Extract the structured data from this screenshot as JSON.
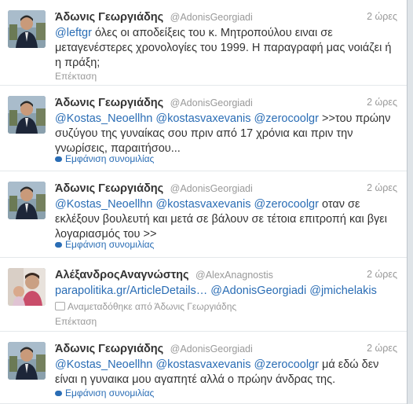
{
  "tweets": [
    {
      "fullname": "Άδωνις Γεωργιάδης",
      "username": "@AdonisGeorgiadi",
      "time": "2 ώρες",
      "mention1": "@leftgr",
      "text": " όλες οι αποδείξεις του κ. Μητροπούλου ειναι σε μεταγενέστερες χρονολογίες του 1999. Η παραγραφή μας νοιάζει ή η πράξη;",
      "action": "Επέκταση"
    },
    {
      "fullname": "Άδωνις Γεωργιάδης",
      "username": "@AdonisGeorgiadi",
      "time": "2 ώρες",
      "mention1": "@Kostas_Neoellhn",
      "mention2": "@kostasvaxevanis",
      "mention3": "@zerocoolgr",
      "text": " >>του πρώην συζύγου της γυναίκας σου πριν από 17 χρόνια και πριν την γνωρίσεις, παραιτήσου...",
      "action": "Εμφάνιση συνομιλίας"
    },
    {
      "fullname": "Άδωνις Γεωργιάδης",
      "username": "@AdonisGeorgiadi",
      "time": "2 ώρες",
      "mention1": "@Kostas_Neoellhn",
      "mention2": "@kostasvaxevanis",
      "mention3": "@zerocoolgr",
      "text": " οταν σε εκλέξουν βουλευτή και μετά σε βάλουν σε τέτοια επιτροπή και βγει λογαριασμός του >>",
      "action": "Εμφάνιση συνομιλίας"
    },
    {
      "fullname": "ΑλέξανδροςΑναγνώστης",
      "username": "@AlexAnagnostis",
      "time": "2 ώρες",
      "link": "parapolitika.gr/ArticleDetails…",
      "mention1": "@AdonisGeorgiadi",
      "mention2": "@jmichelakis",
      "retweeted_by": "Αναμεταδόθηκε από Άδωνις Γεωργιάδης",
      "action": "Επέκταση"
    },
    {
      "fullname": "Άδωνις Γεωργιάδης",
      "username": "@AdonisGeorgiadi",
      "time": "2 ώρες",
      "mention1": "@Kostas_Neoellhn",
      "mention2": "@kostasvaxevanis",
      "mention3": "@zerocoolgr",
      "text": " μά εδώ δεν είναι η γυναικα μου αγαπητέ αλλά ο πρώην άνδρας της.",
      "action": "Εμφάνιση συνομιλίας"
    }
  ]
}
